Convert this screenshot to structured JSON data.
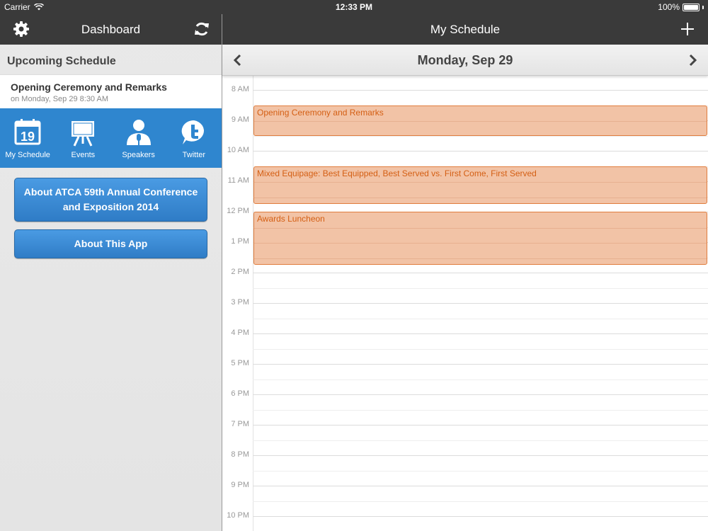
{
  "status_bar": {
    "carrier": "Carrier",
    "time": "12:33 PM",
    "battery": "100%",
    "battery_level": 1.0
  },
  "left": {
    "header_title": "Dashboard",
    "section_title": "Upcoming Schedule",
    "upcoming": {
      "title": "Opening Ceremony and Remarks",
      "subtitle": "on Monday, Sep 29 8:30 AM"
    },
    "nav": [
      {
        "label": "My Schedule",
        "icon": "calendar-icon",
        "icon_text": "19"
      },
      {
        "label": "Events",
        "icon": "easel-icon"
      },
      {
        "label": "Speakers",
        "icon": "speaker-icon"
      },
      {
        "label": "Twitter",
        "icon": "twitter-icon"
      }
    ],
    "about_conference": "About ATCA 59th Annual Conference and Exposition 2014",
    "about_app": "About This App"
  },
  "right": {
    "header_title": "My Schedule",
    "date": "Monday, Sep 29",
    "hours": [
      "8 AM",
      "9 AM",
      "10 AM",
      "11 AM",
      "12 PM",
      "1 PM",
      "2 PM",
      "3 PM",
      "4 PM",
      "5 PM",
      "6 PM",
      "7 PM",
      "8 PM",
      "9 PM",
      "10 PM"
    ],
    "events": [
      {
        "title": "Opening Ceremony and Remarks",
        "start": 8.5,
        "end": 9.5
      },
      {
        "title": "Mixed Equipage: Best Equipped, Best Served vs. First Come, First Served",
        "start": 10.5,
        "end": 11.75
      },
      {
        "title": "Awards Luncheon",
        "start": 12.0,
        "end": 13.75
      }
    ]
  },
  "colors": {
    "header_bg": "#3a3a3a",
    "nav_blue": "#2f86cf",
    "event_fill": "#f2c3a6",
    "event_border": "#e07d3e",
    "event_text": "#d45f14"
  }
}
